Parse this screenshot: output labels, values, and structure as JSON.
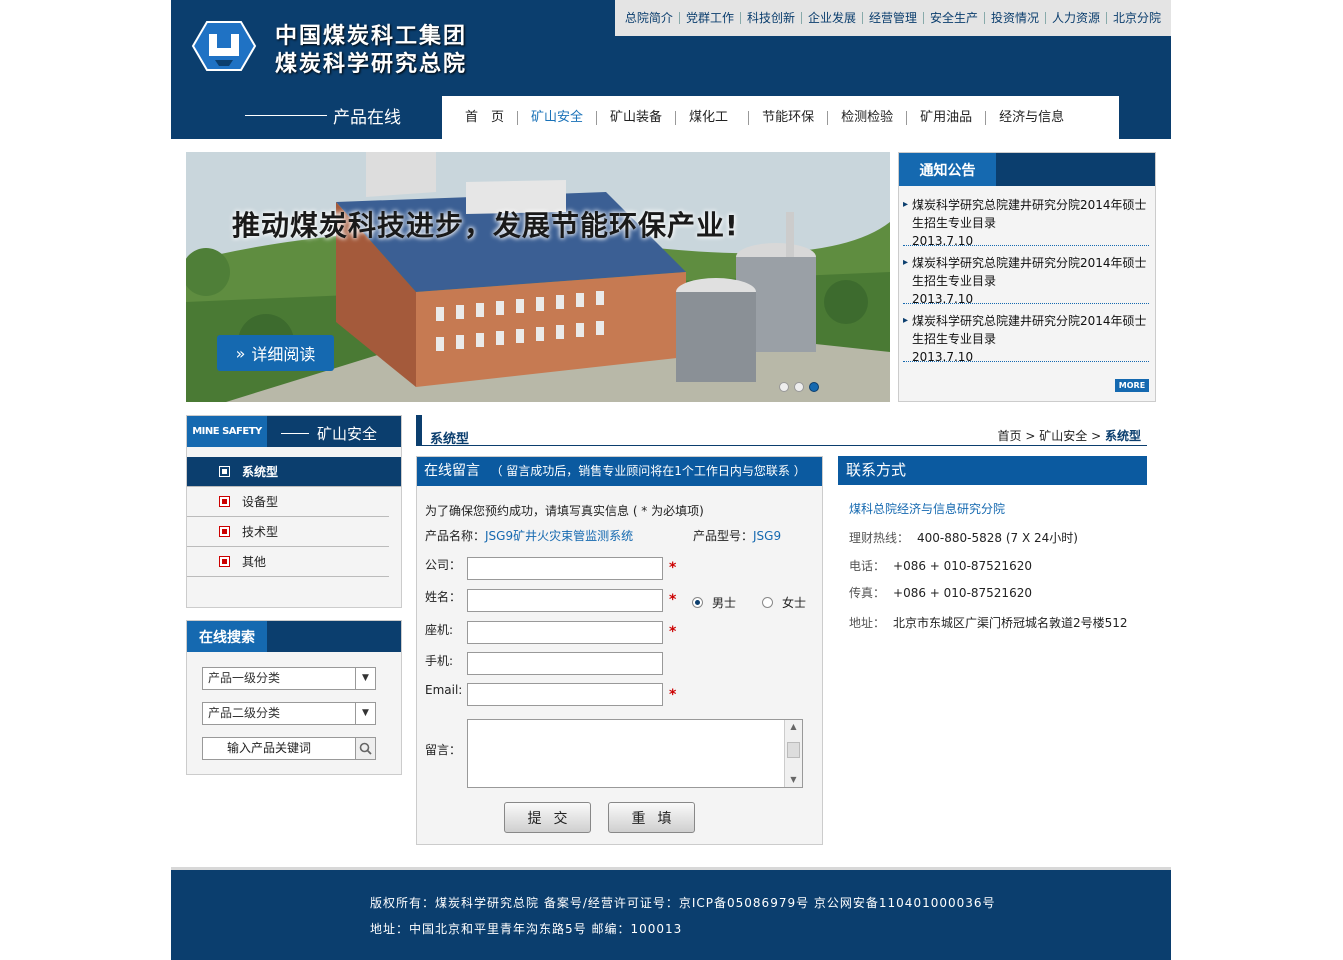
{
  "header": {
    "logo_line1": "中国煤炭科工集团",
    "logo_line2": "煤炭科学研究总院",
    "section_title": "产品在线",
    "top_nav": [
      "总院简介",
      "党群工作",
      "科技创新",
      "企业发展",
      "经营管理",
      "安全生产",
      "投资情况",
      "人力资源",
      "北京分院"
    ],
    "main_nav": [
      "首　页",
      "矿山安全",
      "矿山装备",
      "煤化工",
      "节能环保",
      "检测检验",
      "矿用油品",
      "经济与信息"
    ],
    "main_nav_active": "矿山安全"
  },
  "banner": {
    "headline": "推动煤炭科技进步，发展节能环保产业!",
    "button_label": "详细阅读",
    "slides_count": 3,
    "active_slide": 3
  },
  "notice": {
    "title": "通知公告",
    "items": [
      {
        "text": "煤炭科学研究总院建井研究分院2014年硕士生招生专业目录",
        "date": "2013.7.10"
      },
      {
        "text": "煤炭科学研究总院建井研究分院2014年硕士生招生专业目录",
        "date": "2013.7.10"
      },
      {
        "text": "煤炭科学研究总院建井研究分院2014年硕士生招生专业目录",
        "date": "2013.7.10"
      }
    ],
    "more_label": "MORE"
  },
  "category": {
    "title_en": "MINE SAFETY",
    "title_cn": "矿山安全",
    "items": [
      "系统型",
      "设备型",
      "技术型",
      "其他"
    ],
    "active": "系统型"
  },
  "search": {
    "title": "在线搜索",
    "select1": "产品一级分类",
    "select2": "产品二级分类",
    "keyword_placeholder": "输入产品关键词"
  },
  "crumb": {
    "page_title": "系统型",
    "path": [
      "首页",
      "矿山安全",
      "系统型"
    ],
    "separator": ">"
  },
  "form": {
    "title": "在线留言",
    "note": "（ 留言成功后，销售专业顾问将在1个工作日内与您联系 ）",
    "intro": "为了确保您预约成功，请填写真实信息 ( * 为必填项)",
    "product_name_label": "产品名称：",
    "product_name": "JSG9矿井火灾束管监测系统",
    "product_model_label": "产品型号：",
    "product_model": "JSG9",
    "labels": {
      "company": "公司：",
      "name": "姓名：",
      "phone": "座机:",
      "mobile": "手机:",
      "email": "Email:",
      "message": "留言："
    },
    "gender_male": "男士",
    "gender_female": "女士",
    "gender_selected": "男士",
    "required_mark": "*",
    "submit_label": "提交",
    "reset_label": "重填"
  },
  "contact": {
    "title": "联系方式",
    "org": "煤科总院经济与信息研究分院",
    "hotline_label": "理财热线：",
    "hotline": "400-880-5828  (7 X 24小时)",
    "phone_label": "电话：",
    "phone": "+086 + 010-87521620",
    "fax_label": "传真：",
    "fax": "+086 + 010-87521620",
    "address_label": "地址：",
    "address": "北京市东城区广渠门桥冠城名敦道2号楼512"
  },
  "footer": {
    "line1": "版权所有：煤炭科学研究总院 备案号/经营许可证号：京ICP备05086979号 京公网安备110401000036号",
    "line2": "地址：中国北京和平里青年沟东路5号 邮编：100013"
  },
  "colors": {
    "navy": "#0b3e6e",
    "blue": "#1569b0",
    "required": "#cc0000"
  }
}
